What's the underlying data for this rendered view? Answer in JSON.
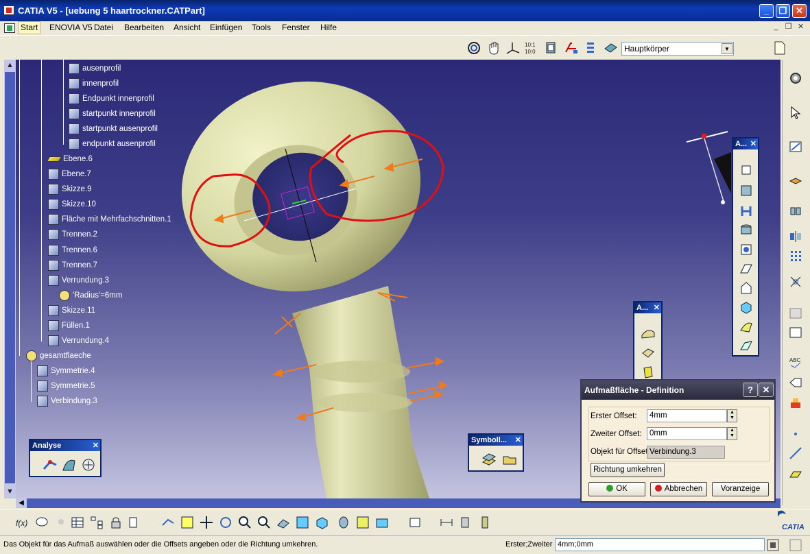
{
  "window": {
    "title": "CATIA V5 - [uebung 5 haartrockner.CATPart]",
    "btn_min": "_",
    "btn_max": "❐",
    "btn_close": "✕"
  },
  "menu": {
    "items": [
      "Start",
      "ENOVIA V5",
      "Datei",
      "Bearbeiten",
      "Ansicht",
      "Einfügen",
      "Tools",
      "Fenster",
      "Hilfe"
    ],
    "mdi_min": "_",
    "mdi_max": "❐",
    "mdi_close": "✕"
  },
  "top_toolbar": {
    "body_select": "Hauptkörper"
  },
  "tree": {
    "nodes": [
      "ausenprofil",
      "innenprofil",
      "Endpunkt innenprofil",
      "startpunkt innenprofil",
      "startpunkt ausenprofil",
      "endpunkt ausenprofil",
      "Ebene.6",
      "Ebene.7",
      "Skizze.9",
      "Skizze.10",
      "Fläche mit Mehrfachschnitten.1",
      "Trennen.2",
      "Trennen.6",
      "Trennen.7",
      "Verrundung.3",
      "'Radius'=6mm",
      "Skizze.11",
      "Füllen.1",
      "Verrundung.4",
      "gesamtflaeche",
      "Symmetrie.4",
      "Symmetrie.5",
      "Verbindung.3"
    ]
  },
  "toolboxes": {
    "analyse_title": "Analyse",
    "symbol_title": "Symboll...",
    "a_small_title": "A...",
    "a_right_title": "A...",
    "close": "✕"
  },
  "dialog": {
    "title": "Aufmaßfläche - Definition",
    "help": "?",
    "close": "✕",
    "first_offset_label": "Erster Offset:",
    "first_offset_value": "4mm",
    "second_offset_label": "Zweiter Offset:",
    "second_offset_value": "0mm",
    "object_label": "Objekt für Offset:",
    "object_value": "Verbindung.3",
    "reverse_button": "Richtung umkehren",
    "ok_button": "OK",
    "cancel_button": "Abbrechen",
    "preview_button": "Voranzeige",
    "ok_color": "#2aa02a",
    "cancel_color": "#d02020"
  },
  "status": {
    "message": "Das Objekt für das Aufmaß auswählen oder die Offsets angeben oder die Richtung umkehren.",
    "prompt_label": "Erster;Zweiter",
    "prompt_value": "4mm;0mm"
  },
  "brand": {
    "logo_text": "CATIA"
  },
  "colors": {
    "viewport_top": "#2c2a78",
    "part_color": "#d9dcae",
    "markup_red": "#e01010",
    "arrow_orange": "#f07a1a"
  }
}
